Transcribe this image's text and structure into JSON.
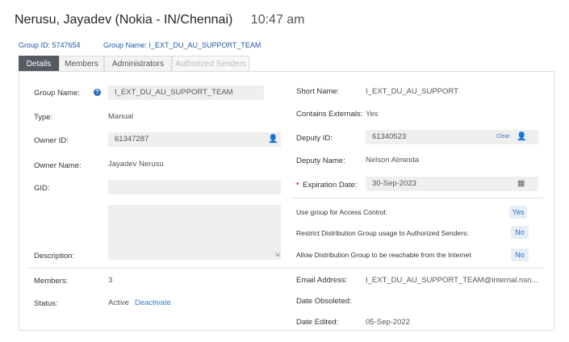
{
  "header": {
    "sender": "Nerusu, Jayadev (Nokia - IN/Chennai)",
    "time": "10:47 am"
  },
  "ids": {
    "group_id": "Group ID: 5747654",
    "group_name": "Group Name: I_EXT_DU_AU_SUPPORT_TEAM"
  },
  "tabs": [
    {
      "label": "Details",
      "active": true
    },
    {
      "label": "Members"
    },
    {
      "label": "Administrators"
    },
    {
      "label": "Authorized Senders",
      "disabled": true
    }
  ],
  "form": {
    "group_name": {
      "label": "Group Name:",
      "value": "I_EXT_DU_AU_SUPPORT_TEAM"
    },
    "type": {
      "label": "Type:",
      "value": "Manual"
    },
    "owner_id": {
      "label": "Owner ID:",
      "value": "61347287"
    },
    "owner_name": {
      "label": "Owner Name:",
      "value": "Jayadev Nerusu"
    },
    "gid": {
      "label": "GID:",
      "value": ""
    },
    "description": {
      "label": "Description:",
      "value": ""
    },
    "members": {
      "label": "Members:",
      "value": "3"
    },
    "status": {
      "label": "Status:",
      "value": "Active",
      "action": "Deactivate"
    },
    "short_name": {
      "label": "Short Name:",
      "value": "I_EXT_DU_AU_SUPPORT"
    },
    "contains_externals": {
      "label": "Contains Externals:",
      "value": "Yes"
    },
    "deputy_id": {
      "label": "Deputy ID:",
      "value": "61340523",
      "clear": "Clear"
    },
    "deputy_name": {
      "label": "Deputy Name:",
      "value": "Nelson Almeida"
    },
    "expiration_date": {
      "label": "Expiration Date:",
      "value": "30-Sep-2023",
      "required_mark": "•"
    },
    "access_control": {
      "label": "Use group for Access Control:",
      "value": "Yes"
    },
    "restrict_distribution": {
      "label": "Restrict Distribution Group usage to Authorized Senders:",
      "value": "No"
    },
    "allow_internet": {
      "label": "Allow Distribution Group to be reachable from the Internet",
      "value": "No"
    },
    "email_address": {
      "label": "Email Address:",
      "value": "I_EXT_DU_AU_SUPPORT_TEAM@internal.nsn..."
    },
    "date_obsoleted": {
      "label": "Date Obsoleted:",
      "value": ""
    },
    "date_edited": {
      "label": "Date Edited:",
      "value": "05-Sep-2022"
    }
  },
  "icons": {
    "help": "help-circle-icon",
    "person_search": "person-add-icon",
    "calendar": "calendar-icon",
    "resize": "resize-handle-icon"
  },
  "colors": {
    "accent": "#3a7cc9",
    "active_tab": "#555b63",
    "required": "#dd3333"
  }
}
